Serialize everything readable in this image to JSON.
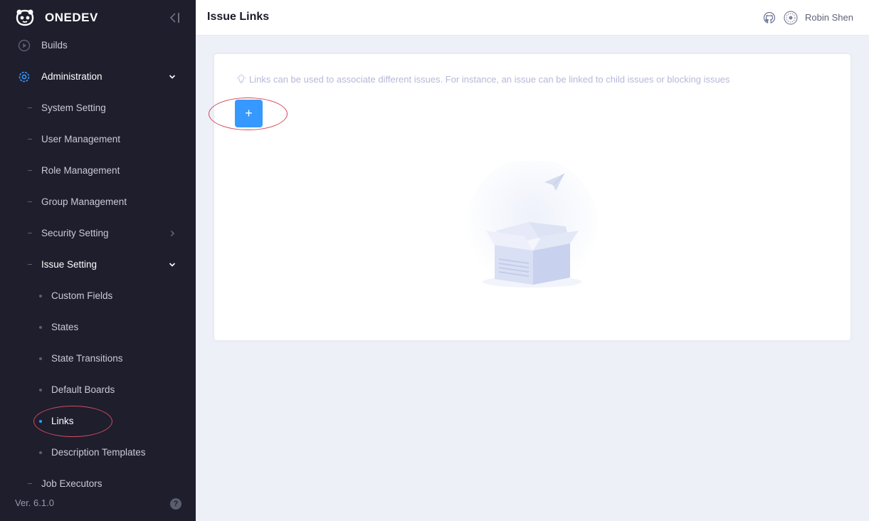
{
  "app": {
    "brand": "ONEDEV",
    "version": "Ver. 6.1.0"
  },
  "sidebar": {
    "items": [
      {
        "label": "Builds"
      },
      {
        "label": "Administration"
      },
      {
        "label": "System Setting"
      },
      {
        "label": "User Management"
      },
      {
        "label": "Role Management"
      },
      {
        "label": "Group Management"
      },
      {
        "label": "Security Setting"
      },
      {
        "label": "Issue Setting"
      },
      {
        "label": "Custom Fields"
      },
      {
        "label": "States"
      },
      {
        "label": "State Transitions"
      },
      {
        "label": "Default Boards"
      },
      {
        "label": "Links"
      },
      {
        "label": "Description Templates"
      },
      {
        "label": "Job Executors"
      }
    ]
  },
  "header": {
    "title": "Issue Links",
    "user": "Robin Shen"
  },
  "main": {
    "tip": "Links can be used to associate different issues. For instance, an issue can be linked to child issues or blocking issues",
    "add_label": "+"
  },
  "colors": {
    "sidebar_bg": "#1e1e2d",
    "accent": "#3699ff",
    "annotation": "#d04a5a"
  }
}
